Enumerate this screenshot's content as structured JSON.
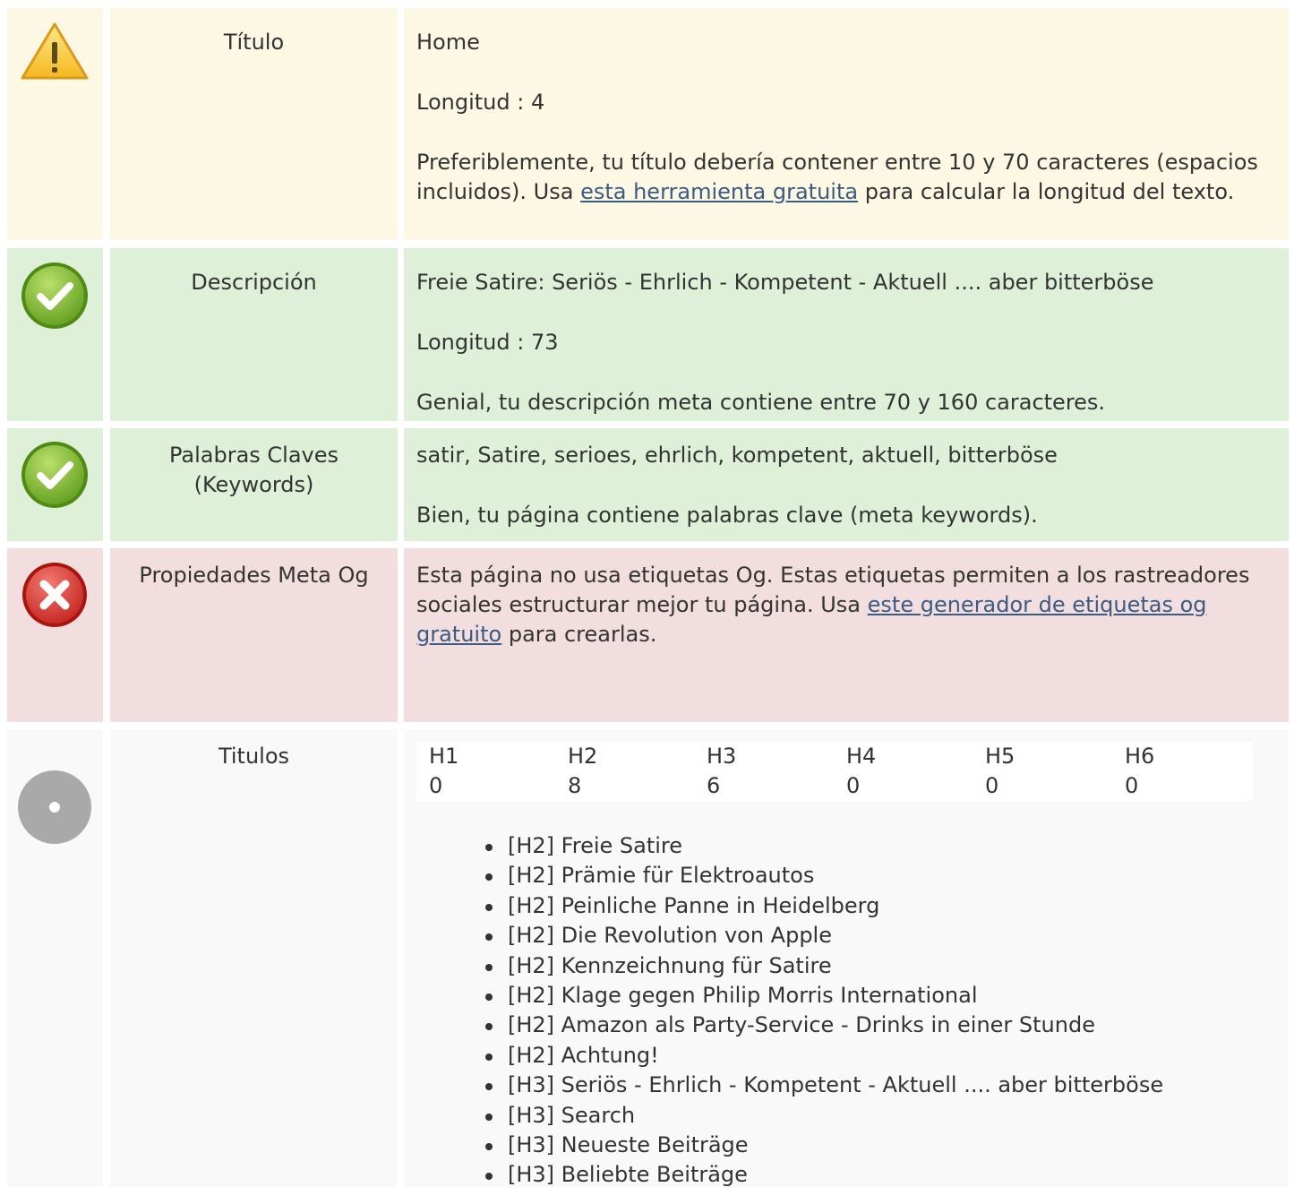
{
  "rows": {
    "title": {
      "label": "Título",
      "value": "Home",
      "length_text": "Longitud : 4",
      "advice_before": "Preferiblemente, tu título debería contener entre 10 y 70 caracteres (espacios incluidos). Usa ",
      "advice_link": "esta herramienta gratuita",
      "advice_after": " para calcular la longitud del texto.",
      "status_icon": "warning-icon"
    },
    "description": {
      "label": "Descripción",
      "value": "Freie Satire: Seriös - Ehrlich - Kompetent - Aktuell .... aber bitterböse",
      "length_text": "Longitud : 73",
      "advice": "Genial, tu descripción meta contiene entre 70 y 160 caracteres.",
      "status_icon": "check-icon"
    },
    "keywords": {
      "label": "Palabras Claves (Keywords)",
      "value": "satir, Satire, serioes, ehrlich, kompetent, aktuell, bitterböse",
      "advice": "Bien, tu página contiene palabras clave (meta keywords).",
      "status_icon": "check-icon"
    },
    "og": {
      "label": "Propiedades Meta Og",
      "text_before": "Esta página no usa etiquetas Og. Estas etiquetas permiten a los rastreadores sociales estructurar mejor tu página. Usa ",
      "link": "este generador de etiquetas og gratuito",
      "text_after": " para crearlas.",
      "status_icon": "error-x-icon"
    },
    "headings": {
      "label": "Titulos",
      "status_icon": "neutral-circle-icon",
      "columns": [
        {
          "tag": "H1",
          "count": "0"
        },
        {
          "tag": "H2",
          "count": "8"
        },
        {
          "tag": "H3",
          "count": "6"
        },
        {
          "tag": "H4",
          "count": "0"
        },
        {
          "tag": "H5",
          "count": "0"
        },
        {
          "tag": "H6",
          "count": "0"
        }
      ],
      "list": [
        "[H2] Freie Satire",
        "[H2] Prämie für Elektroautos",
        "[H2] Peinliche Panne in Heidelberg",
        "[H2] Die Revolution von Apple",
        "[H2] Kennzeichnung für Satire",
        "[H2] Klage gegen Philip Morris International",
        "[H2] Amazon als Party-Service - Drinks in einer Stunde",
        "[H2] Achtung!",
        "[H3] Seriös - Ehrlich - Kompetent - Aktuell .... aber bitterböse",
        "[H3] Search",
        "[H3] Neueste Beiträge",
        "[H3] Beliebte Beiträge"
      ]
    }
  },
  "colors": {
    "warning_bg": "#fcf8e3",
    "success_bg": "#dff0d8",
    "error_bg": "#f2dede",
    "neutral_bg": "#f9f9f9",
    "link": "#3b5b83"
  }
}
